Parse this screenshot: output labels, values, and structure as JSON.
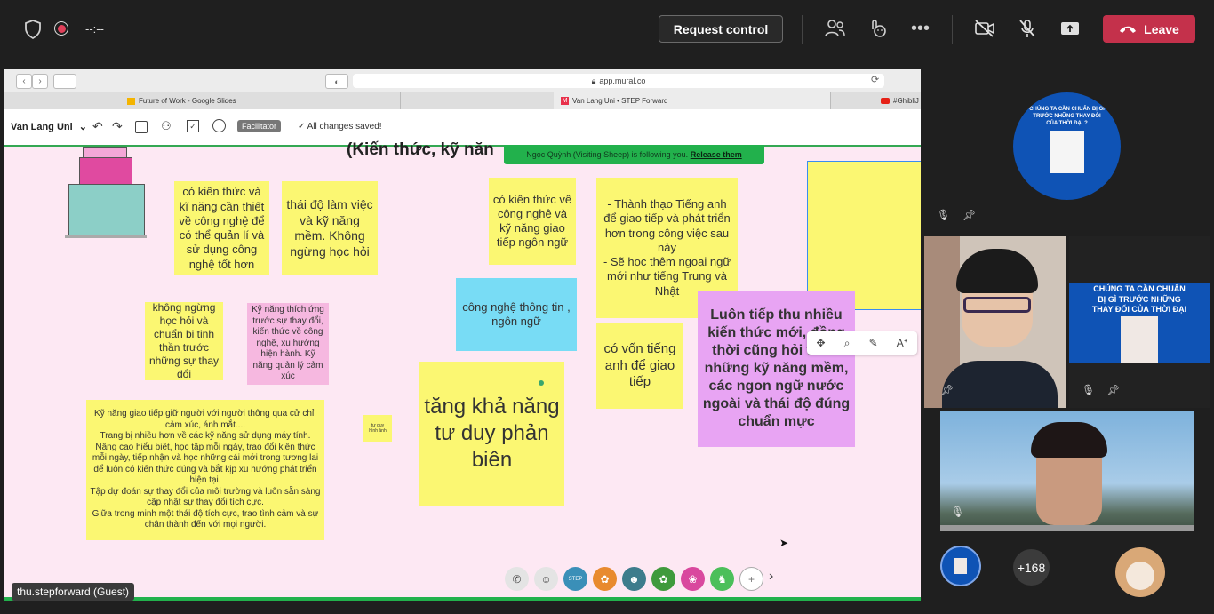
{
  "topbar": {
    "timer": "--:--",
    "request_control": "Request control",
    "leave": "Leave",
    "icons": [
      "shield-icon",
      "record-icon",
      "participants-icon",
      "reactions-icon",
      "more-icon",
      "camera-off-icon",
      "mic-off-icon",
      "share-icon",
      "hangup-icon"
    ]
  },
  "browser": {
    "url": "app.mural.co",
    "tabs": [
      {
        "label": "Future of Work - Google Slides"
      },
      {
        "label": "Van Lang Uni • STEP Forward"
      },
      {
        "label": "#GhibliJ"
      }
    ]
  },
  "mural": {
    "workspace": "Van Lang Uni",
    "facilitator": "Facilitator",
    "saved": "All changes saved!",
    "title": "(Kiến thức, kỹ năn",
    "follow_text": "Ngọc Quỳnh (Visiting Sheep) is following you.",
    "release": "Release them"
  },
  "notes": {
    "n1": "có kiến thức và kĩ năng cần thiết về công nghệ để có thể quản lí và sử dụng công nghệ tốt hơn",
    "n2": "thái độ làm việc và kỹ năng mềm. Không ngừng học hỏi",
    "n3": "có kiến thức về công nghệ và kỹ năng giao tiếp ngôn ngữ",
    "n4": "- Thành thạo Tiếng anh để giao tiếp và phát triển hơn trong công việc sau này\n- Sẽ học thêm ngoại ngữ mới như tiếng Trung và Nhật",
    "n5": "không ngừng học hỏi và chuẩn bị tinh thần trước những sự thay đổi",
    "n6": "Kỹ năng thích ứng trước sự thay đổi, kiến thức về công nghệ, xu hướng hiện hành. Kỹ năng quản lý cảm xúc",
    "n7": "công nghệ thông tin , ngôn ngữ",
    "n8": "Luôn tiếp thu nhiều kiến thức mới, đồng thời cũng hỏi thêm những kỹ năng mềm, các ngon ngữ nước ngoài và thái độ đúng chuẩn mực",
    "n9": "có vốn tiếng anh để giao tiếp",
    "n10": "tăng khả năng tư duy phản biên",
    "n11": "Kỹ năng giao tiếp giữ người với người thông qua cử chỉ, cảm xúc, ánh mắt....\nTrang bị  nhiều hơn về các kỹ năng sử dụng máy tính.\nNâng cao hiểu biết, học tập mỗi ngày, trao đổi kiến thức mỗi ngày, tiếp nhận và học những cái mới trong tương lai để luôn có kiến thức đúng và bắt kịp xu hướng phát triển hiện tại.\nTập dự đoán sự thay đổi của môi trường và luôn sẵn sàng cập nhật sự thay đổi tích cực.\nGiữa trong minh một thái độ tích cực, trao tình cảm và sự chân thành đến với mọi người.",
    "n12": "tư duy hình ảnh"
  },
  "guest_label": "thu.stepforward (Guest)",
  "panel": {
    "slide_text": "CHÚNG TA CẦN CHUẨN BỊ GÌ TRƯỚC NHỮNG THAY ĐỔI CỦA THỜI ĐẠI ?",
    "more_count": "+168"
  },
  "colors": {
    "leave": "#c4314b",
    "note_yellow": "#fbf772",
    "note_blue": "#78dcf5",
    "note_pink": "#f6b8e0",
    "note_purple": "#e8a4f3",
    "banner_green": "#22b14c"
  }
}
